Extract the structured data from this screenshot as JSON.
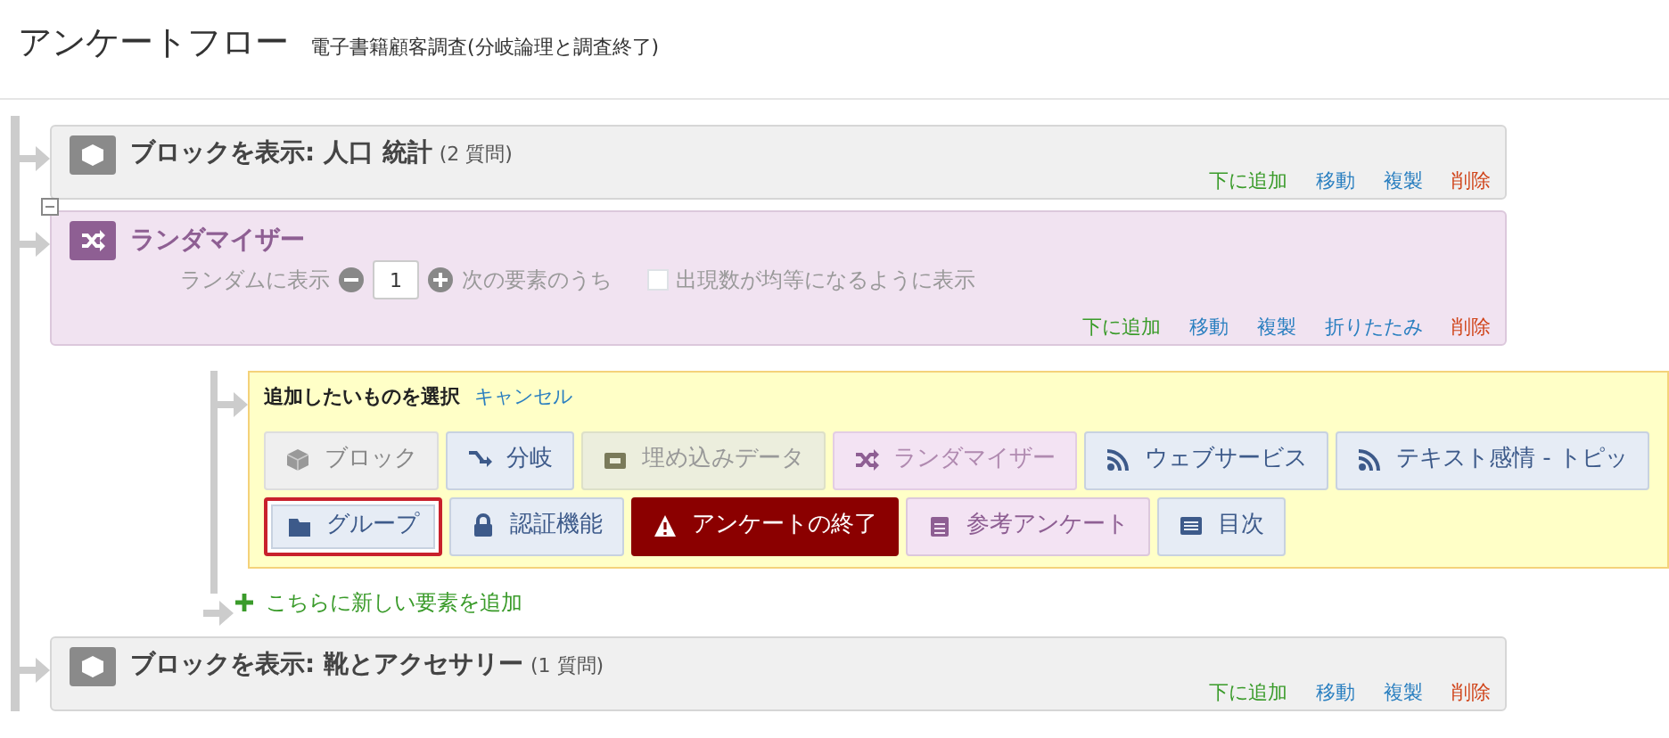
{
  "header": {
    "title": "アンケートフロー",
    "subtitle": "電子書籍顧客調査(分岐論理と調査終了)"
  },
  "flow": [
    {
      "kind": "block",
      "title": "ブロックを表示: 人口 統計",
      "count": "(2 質問)",
      "actions": [
        {
          "label": "下に追加",
          "kind": "add"
        },
        {
          "label": "移動",
          "kind": "move"
        },
        {
          "label": "複製",
          "kind": "copy"
        },
        {
          "label": "削除",
          "kind": "delete"
        }
      ]
    },
    {
      "kind": "randomizer",
      "collapsible": true,
      "title": "ランダマイザー",
      "show_label": "ランダムに表示",
      "value": "1",
      "suffix": "次の要素のうち",
      "checkbox": {
        "label": "出現数が均等になるように表示",
        "checked": false
      },
      "actions": [
        {
          "label": "下に追加",
          "kind": "add"
        },
        {
          "label": "移動",
          "kind": "move"
        },
        {
          "label": "複製",
          "kind": "copy"
        },
        {
          "label": "折りたたみ",
          "kind": "collapse"
        },
        {
          "label": "削除",
          "kind": "delete"
        }
      ],
      "add_panel": {
        "title": "追加したいものを選択",
        "cancel": "キャンセル",
        "button_rows": [
          [
            {
              "label": "ブロック",
              "kind": "block",
              "highlighted": false
            },
            {
              "label": "分岐",
              "kind": "branch",
              "highlighted": false
            },
            {
              "label": "埋め込みデータ",
              "kind": "embedded",
              "highlighted": false
            },
            {
              "label": "ランダマイザー",
              "kind": "randomizer",
              "highlighted": false
            },
            {
              "label": "ウェブサービス",
              "kind": "web",
              "highlighted": false
            },
            {
              "label": "テキスト感情 - トピッ",
              "kind": "web",
              "highlighted": false
            }
          ],
          [
            {
              "label": "グループ",
              "kind": "group",
              "highlighted": true
            },
            {
              "label": "認証機能",
              "kind": "auth",
              "highlighted": false
            },
            {
              "label": "アンケートの終了",
              "kind": "end",
              "highlighted": false
            },
            {
              "label": "参考アンケート",
              "kind": "reference",
              "highlighted": false
            },
            {
              "label": "目次",
              "kind": "toc",
              "highlighted": false
            }
          ]
        ]
      },
      "add_link": "こちらに新しい要素を追加"
    },
    {
      "kind": "block",
      "title": "ブロックを表示: 靴とアクセサリー",
      "count": "(1 質問)",
      "actions": [
        {
          "label": "下に追加",
          "kind": "add"
        },
        {
          "label": "移動",
          "kind": "move"
        },
        {
          "label": "複製",
          "kind": "copy"
        },
        {
          "label": "削除",
          "kind": "delete"
        }
      ]
    }
  ]
}
